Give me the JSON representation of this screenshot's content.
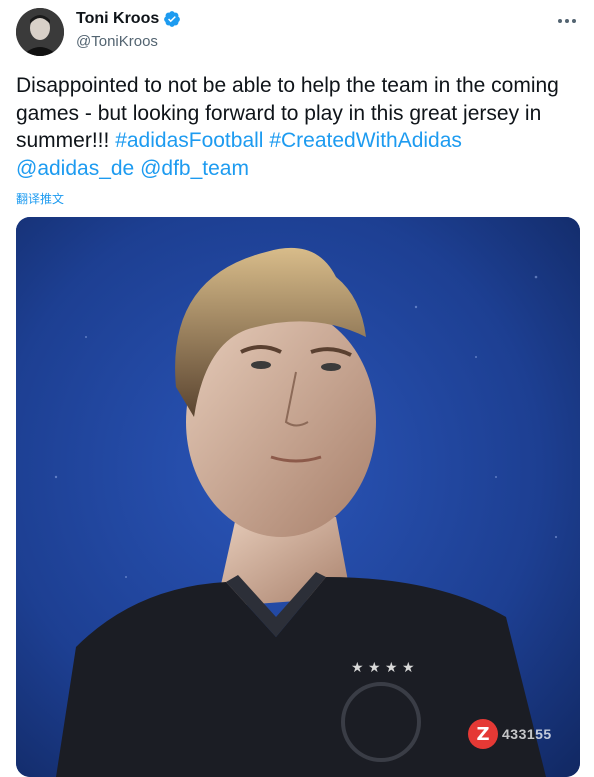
{
  "author": {
    "display_name": "Toni Kroos",
    "handle": "@ToniKroos",
    "avatar_icon": "user-avatar-photo",
    "verified_icon": "verified-badge-icon",
    "verified_color": "#1d9bf0"
  },
  "more_icon": "more-options-icon",
  "tweet": {
    "text_plain": "Disappointed to not be able to help the team in the coming games - but looking forward to play in this great jersey in summer!!! ",
    "hashtag_1": "#adidasFootball",
    "hashtag_2": "#CreatedWithAdidas",
    "mention_1": "@adidas_de",
    "mention_2": "@dfb_team",
    "translate_label": "翻译推文"
  },
  "media": {
    "type": "photo",
    "background_color": "#1e3f8f"
  },
  "watermark": {
    "logo_letter": "Z",
    "text": "433155"
  },
  "colors": {
    "link": "#1d9bf0",
    "text": "#0f1419",
    "secondary": "#536471"
  }
}
